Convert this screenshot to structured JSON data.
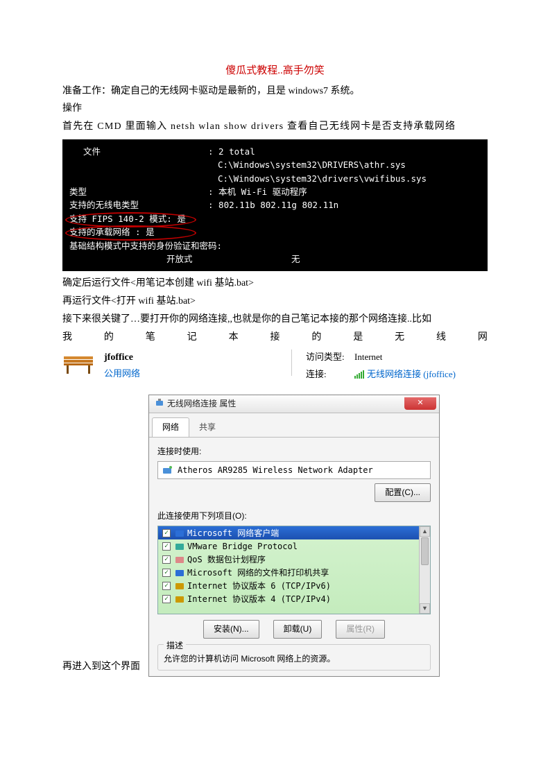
{
  "title": "傻瓜式教程..高手勿笑",
  "p1": "准备工作：确定自己的无线网卡驱动是最新的，且是 windows7 系统。",
  "p2": "操作",
  "p3": "首先在 CMD 里面输入 netsh wlan show drivers 查看自己无线网卡是否支持承载网络",
  "term": {
    "l0": "文件",
    "l0r": ": 2 total",
    "l1r": "C:\\Windows\\system32\\DRIVERS\\athr.sys",
    "l2r": "C:\\Windows\\system32\\drivers\\vwifibus.sys",
    "l3": "类型",
    "l3r": ": 本机 Wi-Fi 驱动程序",
    "l4": "支持的无线电类型",
    "l4r": ": 802.11b 802.11g 802.11n",
    "l5": "支持 FIPS 140-2 模式: 是",
    "l6": "支持的承载网络  : 是",
    "l7": "基础结构模式中支持的身份验证和密码:",
    "l8l": "开放式",
    "l8r": "无"
  },
  "p4": "确定后运行文件<用笔记本创建 wifi 基站.bat>",
  "p5": "再运行文件<打开 wifi 基站.bat>",
  "p6": "接下来很关键了…要打开你的网络连接,,也就是你的自己笔记本接的那个网络连接..比如",
  "p7chars": [
    "我",
    "的",
    "笔",
    "记",
    "本",
    "接",
    "的",
    "是",
    "无",
    "线",
    "网"
  ],
  "net": {
    "name": "jfoffice",
    "type": "公用网络",
    "accessLabel": "访问类型:",
    "accessVal": "Internet",
    "connLabel": "连接:",
    "connVal": "无线网络连接 (jfoffice)"
  },
  "p8": "再进入到这个界面",
  "win": {
    "title": "无线网络连接 属性",
    "tab1": "网络",
    "tab2": "共享",
    "connUse": "连接时使用:",
    "adapter": "Atheros AR9285 Wireless Network Adapter",
    "configBtn": "配置(C)...",
    "itemsLabel": "此连接使用下列项目(O):",
    "items": [
      "Microsoft 网络客户端",
      "VMware Bridge Protocol",
      "QoS 数据包计划程序",
      "Microsoft 网络的文件和打印机共享",
      "Internet 协议版本 6 (TCP/IPv6)",
      "Internet 协议版本 4 (TCP/IPv4)"
    ],
    "install": "安装(N)...",
    "uninstall": "卸载(U)",
    "props": "属性(R)",
    "descLabel": "描述",
    "descText": "允许您的计算机访问 Microsoft 网络上的资源。"
  }
}
